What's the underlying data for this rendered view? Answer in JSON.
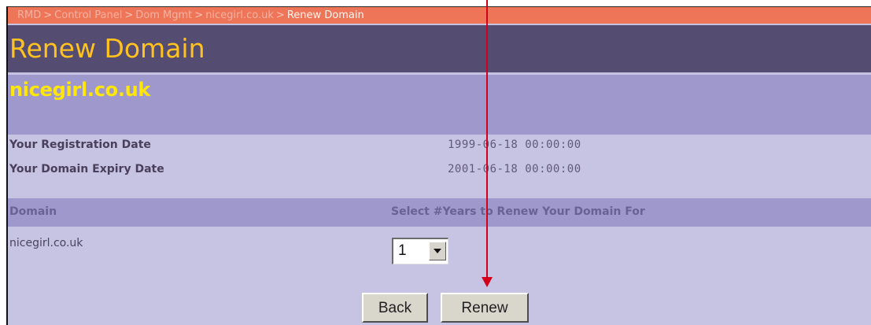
{
  "breadcrumb": {
    "items": [
      "RMD",
      "Control Panel",
      "Dom Mgmt",
      "nicegirl.co.uk"
    ],
    "current": "Renew Domain",
    "separator": ">"
  },
  "page": {
    "title": "Renew Domain",
    "domain_heading": "nicegirl.co.uk"
  },
  "info": {
    "registration_label": "Your Registration Date",
    "registration_value": "1999-06-18 00:00:00",
    "expiry_label": "Your Domain Expiry Date",
    "expiry_value": "2001-06-18 00:00:00"
  },
  "table": {
    "columns": [
      "Domain",
      "Select #Years to Renew Your Domain For"
    ],
    "rows": [
      {
        "domain": "nicegirl.co.uk",
        "years": "1"
      }
    ]
  },
  "buttons": {
    "back": "Back",
    "renew": "Renew"
  },
  "icons": {
    "dropdown": "chevron-down-icon"
  },
  "colors": {
    "breadcrumb_bg": "#ef7558",
    "title_bar_bg": "#554c72",
    "title_text": "#ffc21e",
    "domain_bar_bg": "#9f98cc",
    "domain_text": "#ffe60a",
    "content_bg": "#c6c4e2",
    "annotation_arrow": "#d4001a"
  }
}
